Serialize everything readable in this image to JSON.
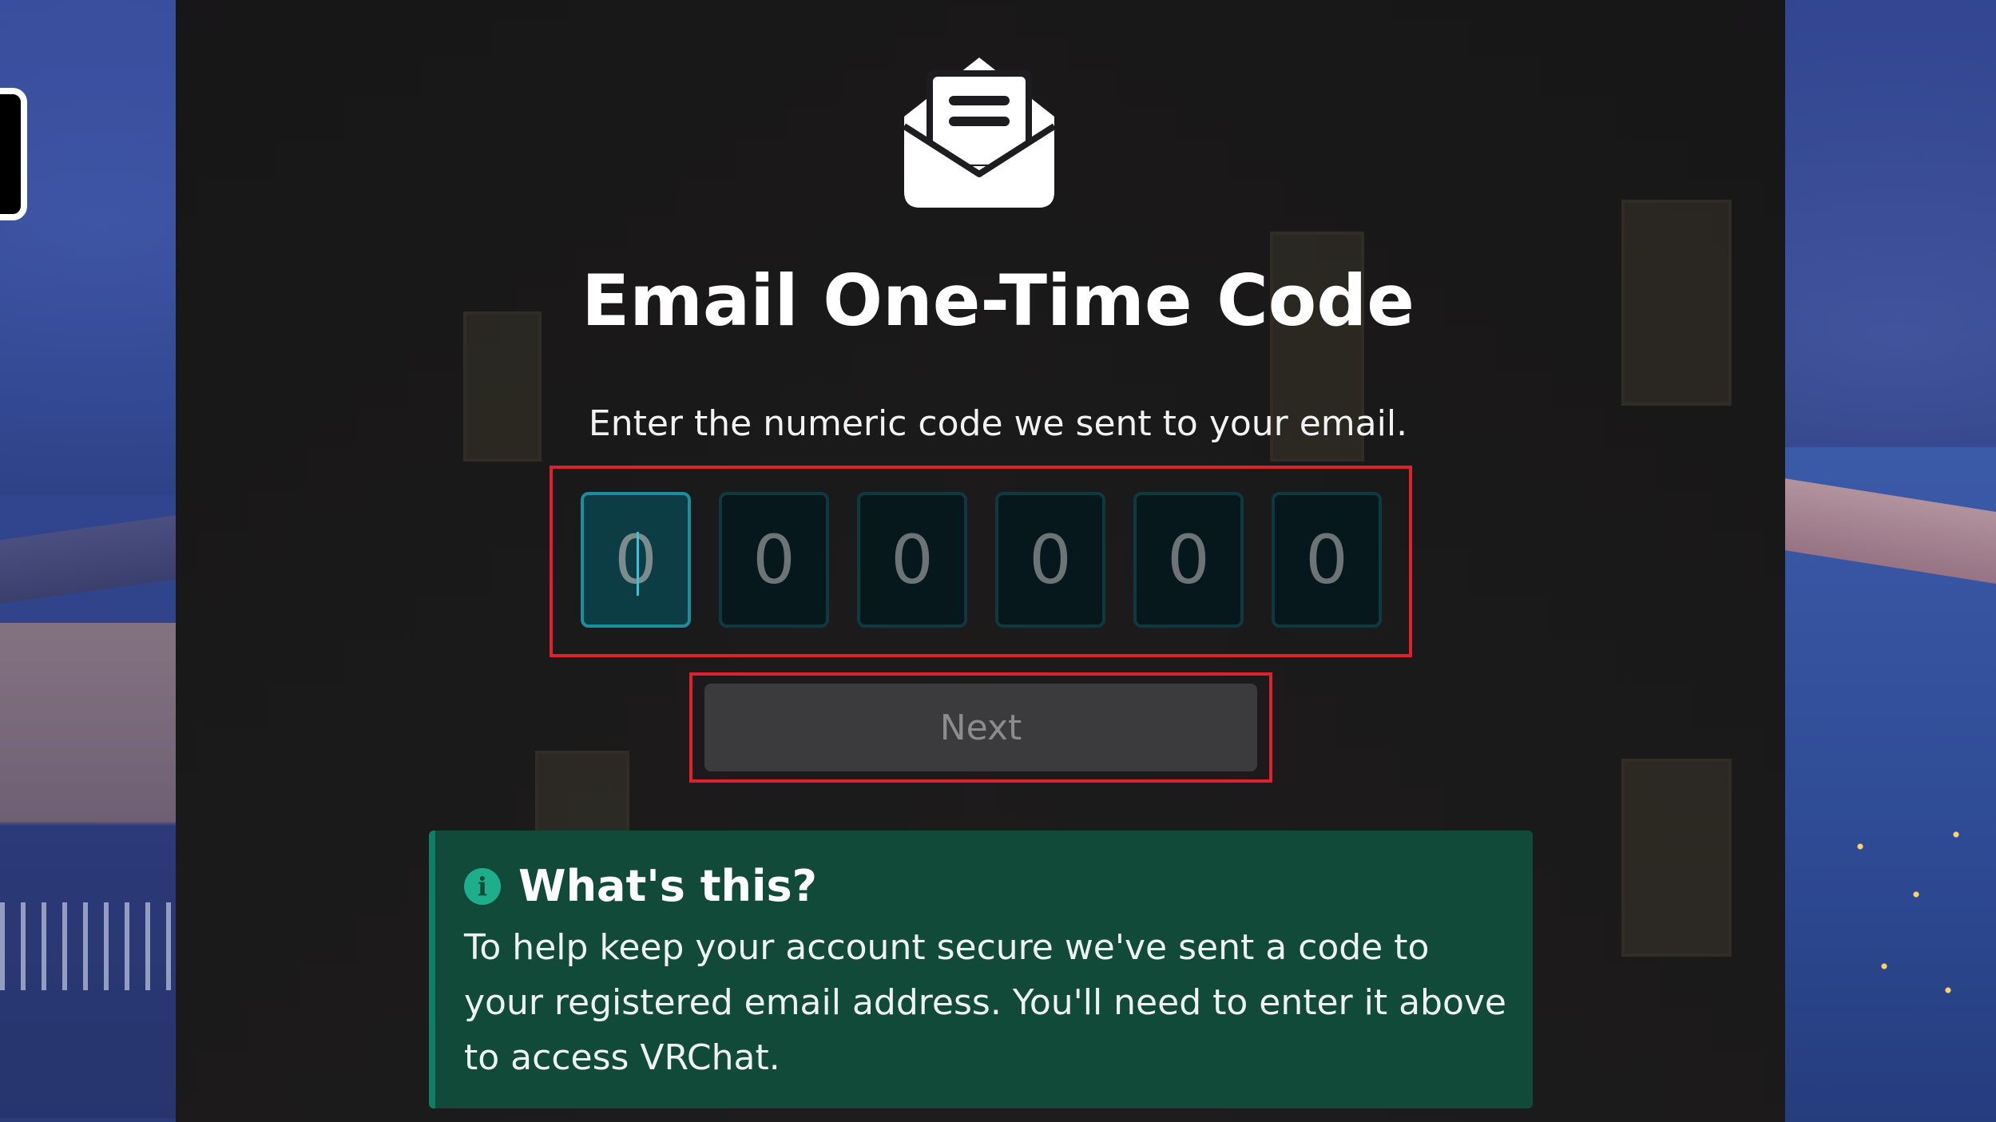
{
  "page": {
    "title": "Email One-Time Code",
    "subtitle": "Enter the numeric code we sent to your email."
  },
  "icons": {
    "envelope": "open-envelope-icon",
    "info": "info-circle-icon"
  },
  "code_input": {
    "digits": [
      {
        "placeholder": "0",
        "value": ""
      },
      {
        "placeholder": "0",
        "value": ""
      },
      {
        "placeholder": "0",
        "value": ""
      },
      {
        "placeholder": "0",
        "value": ""
      },
      {
        "placeholder": "0",
        "value": ""
      },
      {
        "placeholder": "0",
        "value": ""
      }
    ]
  },
  "actions": {
    "next_label": "Next"
  },
  "info_box": {
    "icon_glyph": "i",
    "title": "What's this?",
    "body": "To help keep your account secure we've sent a code to your registered email address. You'll need to enter it above to access VRChat."
  },
  "colors": {
    "highlight_border": "#e0202c",
    "active_digit_border": "#1a8e9e",
    "info_background": "#124a3a",
    "info_accent": "#0d7f62",
    "next_button_bg": "#3b3b3d"
  }
}
